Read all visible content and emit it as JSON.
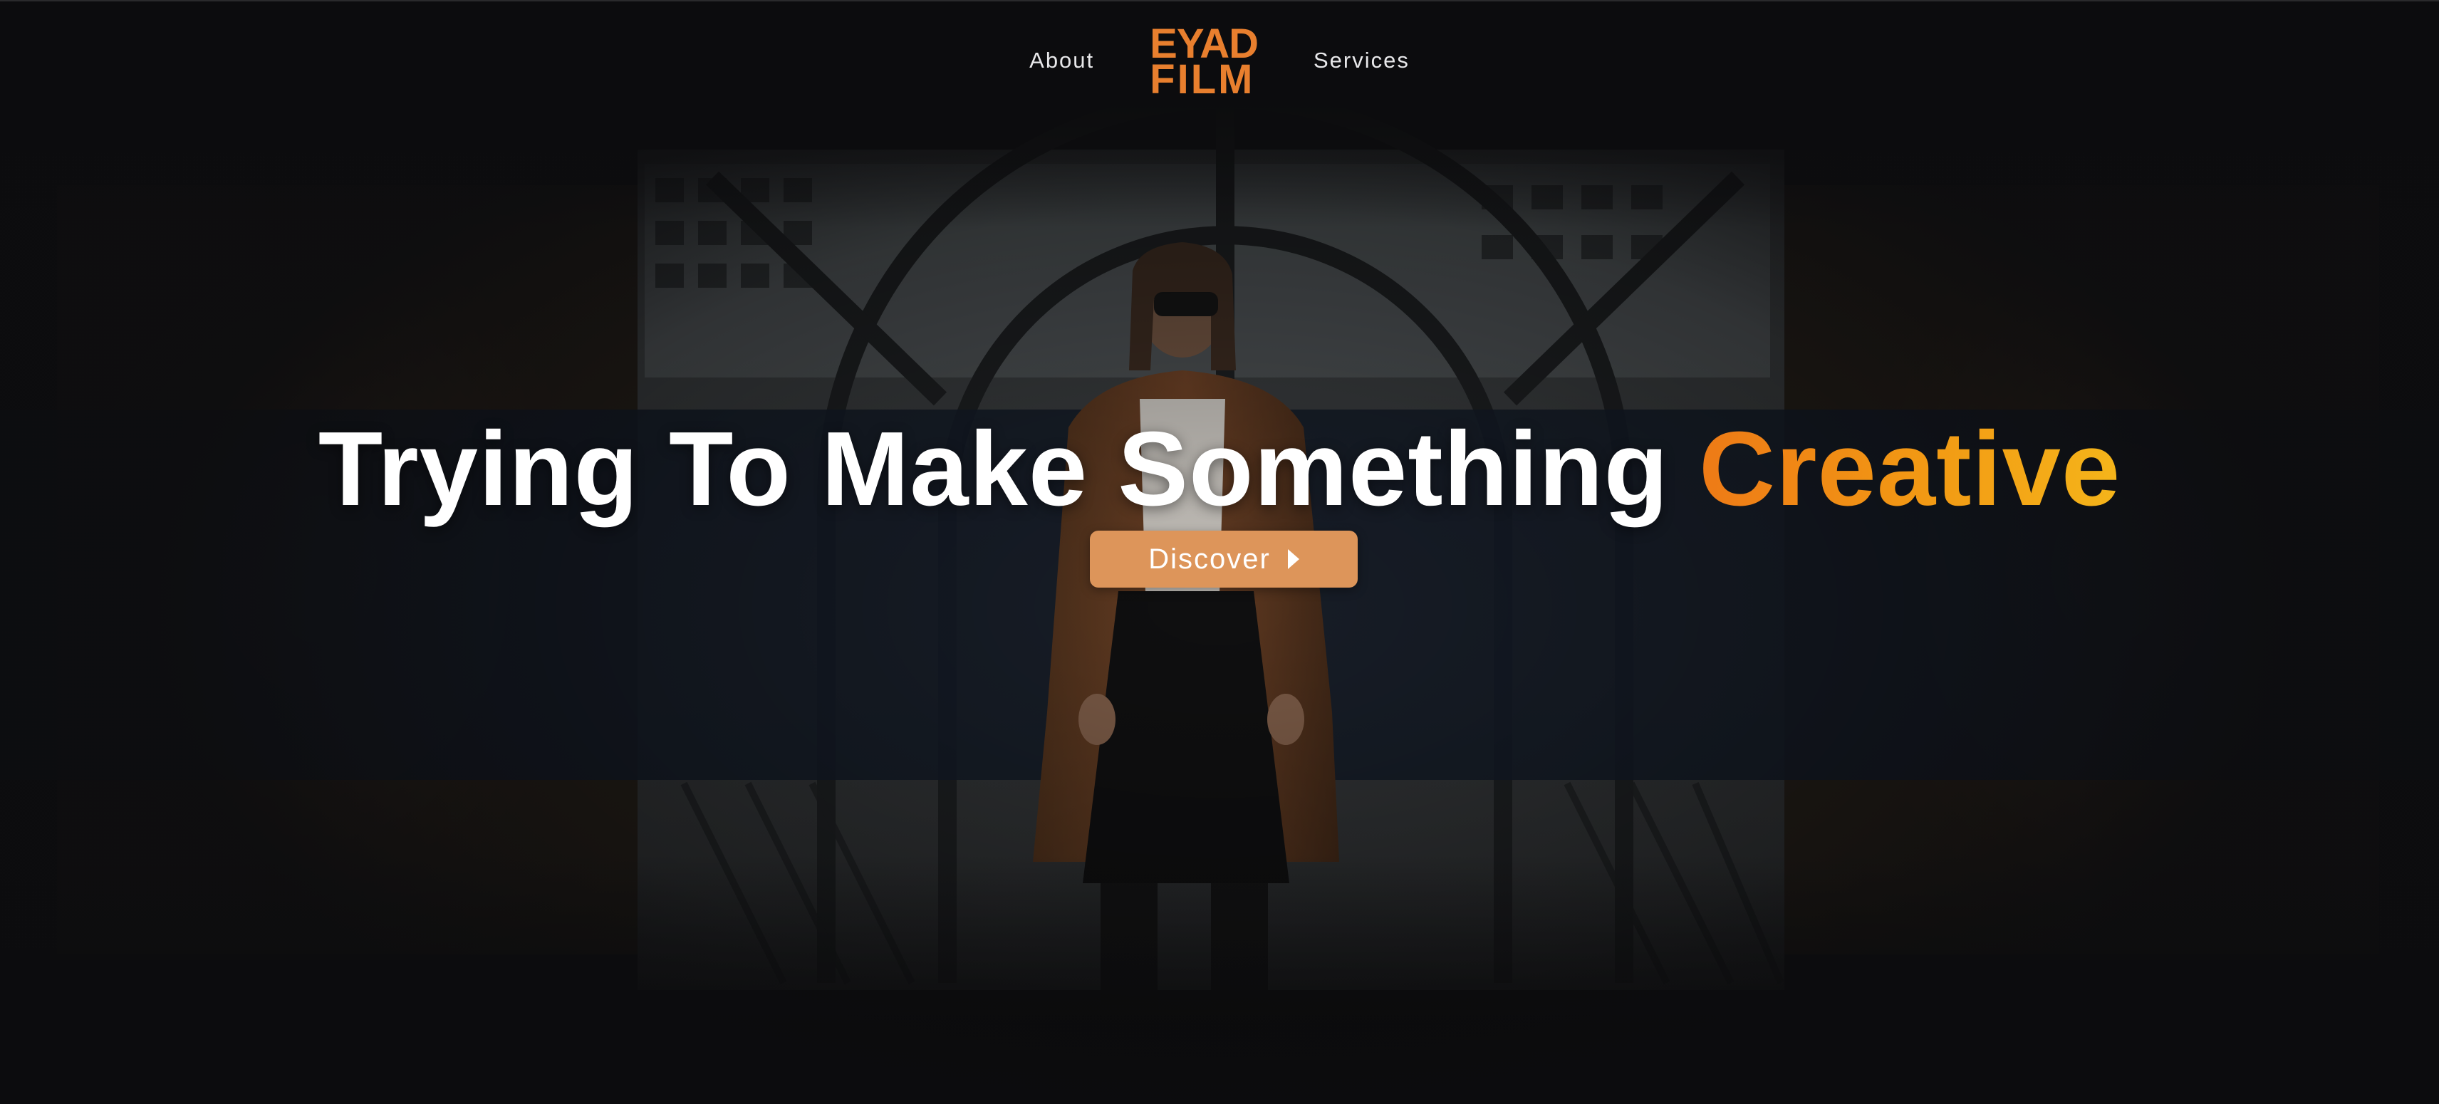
{
  "nav": {
    "left_link": "About",
    "right_link": "Services"
  },
  "logo": {
    "line1": "EYAD",
    "line2": "FILM",
    "color": "#e87f2e"
  },
  "hero": {
    "title_main": "Trying To Make Something",
    "title_accent": "Creative",
    "accent_gradient": [
      "#ee7a16",
      "#f5b51a"
    ],
    "button_label": "Discover",
    "button_icon": "play-triangle-icon",
    "button_color": "#dd955a"
  },
  "background": {
    "image_subject": "person in long brown coat standing in front of arched window",
    "overlay_color": "#111113"
  }
}
